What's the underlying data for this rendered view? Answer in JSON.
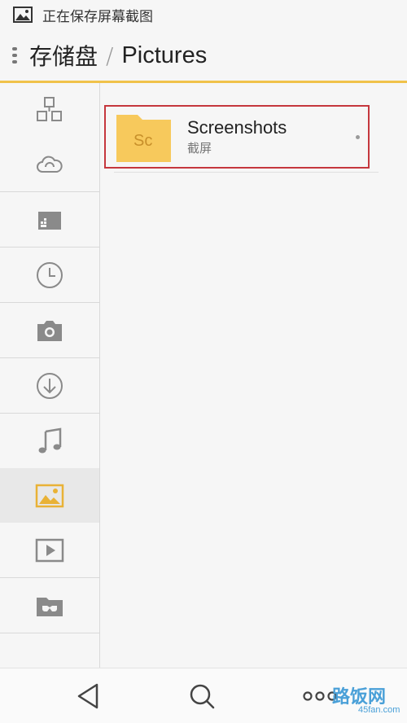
{
  "status_bar": {
    "icon": "image-icon",
    "text": "正在保存屏幕截图"
  },
  "header": {
    "menu_icon": "drag-handle-icon",
    "breadcrumb": {
      "root": "存储盘",
      "separator": "/",
      "current": "Pictures"
    }
  },
  "sidebar": {
    "items": [
      {
        "icon": "category-icon",
        "active": false
      },
      {
        "icon": "cloud-icon",
        "active": false
      },
      {
        "icon": "sd-card-icon",
        "active": false
      },
      {
        "icon": "clock-icon",
        "active": false
      },
      {
        "icon": "camera-icon",
        "active": false
      },
      {
        "icon": "download-icon",
        "active": false
      },
      {
        "icon": "music-icon",
        "active": false
      },
      {
        "icon": "picture-icon",
        "active": true
      },
      {
        "icon": "video-icon",
        "active": false
      },
      {
        "icon": "private-folder-icon",
        "active": false
      }
    ]
  },
  "folders": [
    {
      "abbr": "Sc",
      "name": "Screenshots",
      "subtitle": "截屏",
      "icon": "folder-icon"
    }
  ],
  "bottom_nav": {
    "back_icon": "back-icon",
    "search_icon": "search-icon",
    "more_icon": "more-icon"
  },
  "watermark": {
    "text": "路饭网",
    "sub": "45fan.com"
  },
  "colors": {
    "accent": "#f0c24a",
    "folder": "#f7c95c",
    "folder_text": "#c8902a",
    "highlight_border": "#c5373d",
    "icon_gray": "#8a8a8a",
    "active_icon": "#e9b236"
  }
}
